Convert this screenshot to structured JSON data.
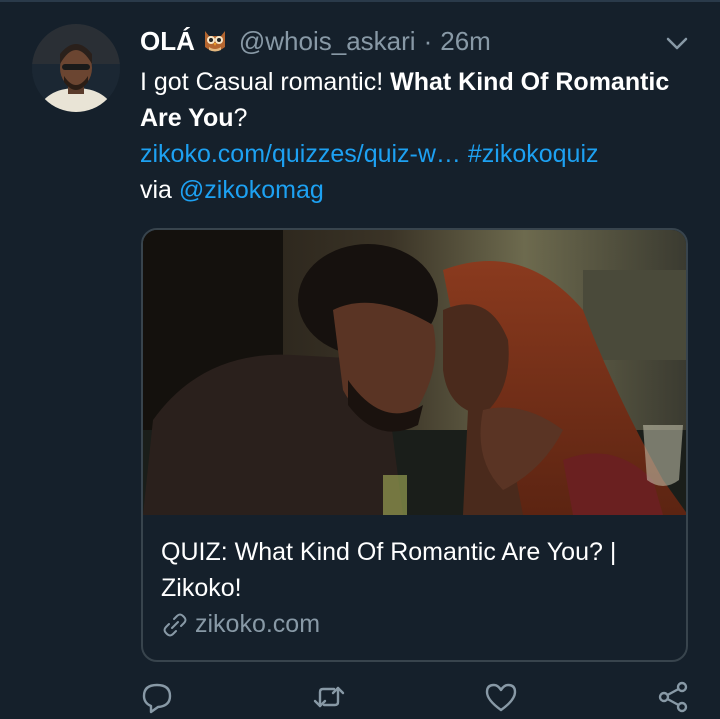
{
  "tweet": {
    "author_name": "OLÁ",
    "author_handle": "@whois_askari",
    "separator": "·",
    "time": "26m",
    "text_plain": "I got Casual romantic! ",
    "text_bold": "What Kind Of Romantic Are You",
    "text_end": "?",
    "link_url": "zikoko.com/quizzes/quiz-w…",
    "hashtag": "#zikokoquiz",
    "via_text": "via ",
    "via_handle": "@zikokomag"
  },
  "card": {
    "title": "QUIZ: What Kind Of Romantic Are You? | Zikoko!",
    "domain": "zikoko.com"
  },
  "icons": {
    "owl": "owl-emoji",
    "more": "chevron-down-icon",
    "link": "link-icon",
    "reply": "reply-icon",
    "retweet": "retweet-icon",
    "like": "heart-icon",
    "share": "share-icon"
  },
  "colors": {
    "background": "#15202b",
    "link": "#1da1f2",
    "muted": "#8899a6",
    "border": "#38444d"
  }
}
